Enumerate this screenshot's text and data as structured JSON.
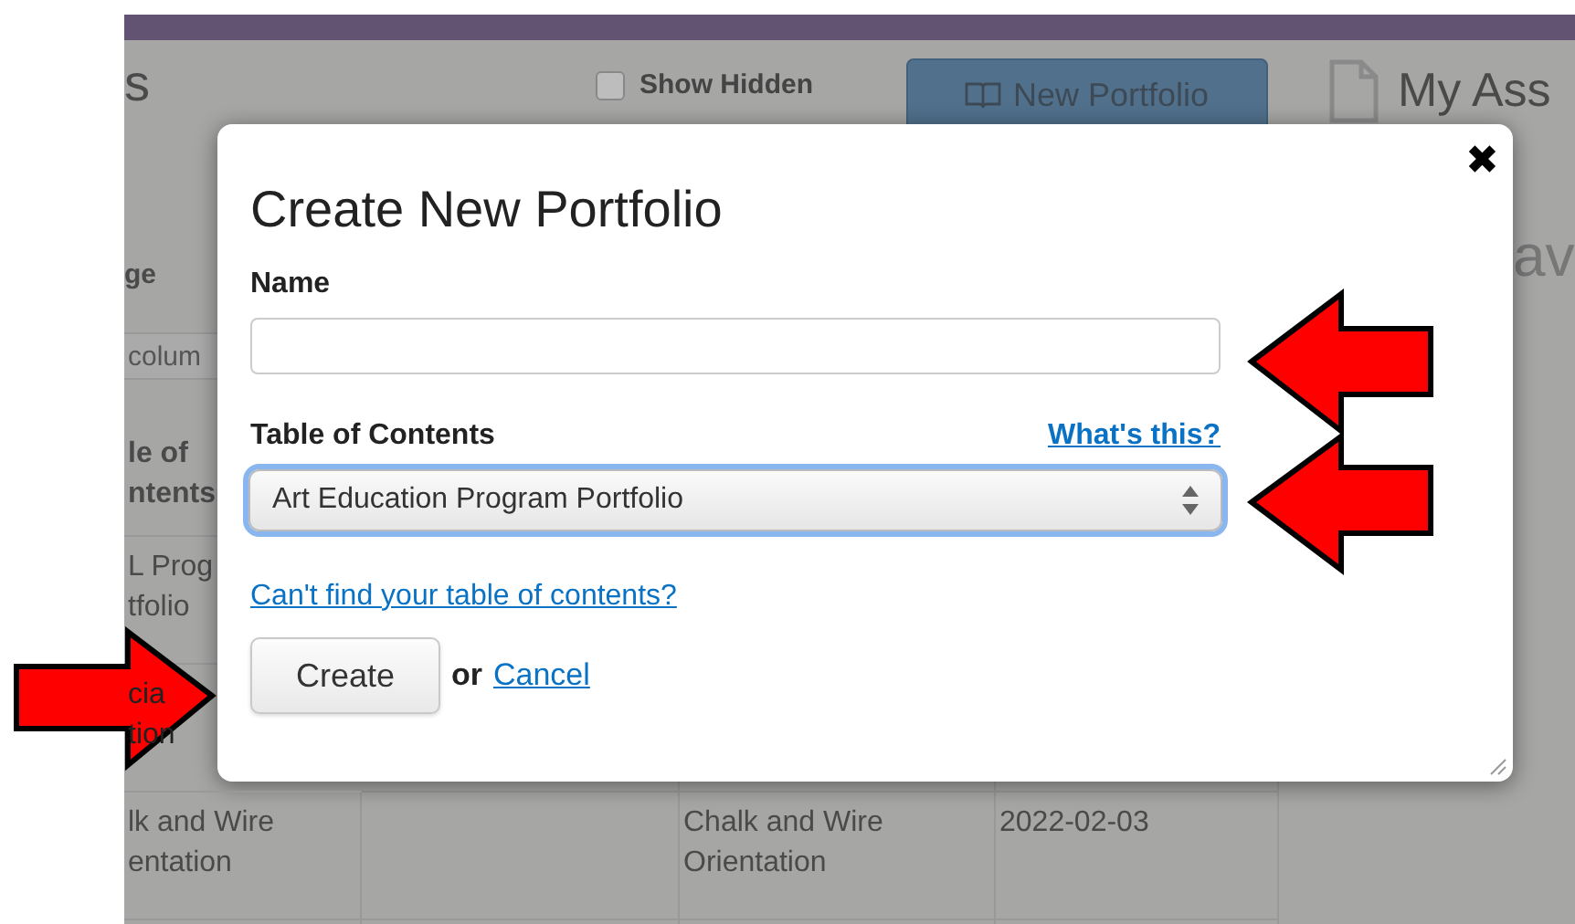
{
  "page": {
    "title_fragment": "s",
    "show_hidden": {
      "label": "Show Hidden",
      "checked": false
    },
    "new_portfolio_button": "New Portfolio",
    "my_assessments": "My Ass",
    "subtitle_fragment": "av",
    "column_label_fragment": "ge",
    "filter_placeholder": "colum"
  },
  "table": {
    "columns": [
      {
        "column_1": [
          "le of",
          "ntents"
        ]
      }
    ],
    "rows": [
      {
        "column_1": [
          "L Prog",
          "tfolio"
        ]
      },
      {
        "column_1": [
          "cia",
          "tion"
        ]
      },
      {
        "column_1": [
          "lk and Wire",
          "entation"
        ],
        "column_3": [
          "Chalk and Wire",
          "Orientation"
        ],
        "column_4": [
          "2022-02-03"
        ]
      }
    ]
  },
  "dialog": {
    "title": "Create New Portfolio",
    "close": "✖",
    "name_label": "Name",
    "toc_label": "Table of Contents",
    "whats_this": "What's this?",
    "toc_value": "Art Education Program Portfolio",
    "toc_focused": true,
    "cant_find": "Can't find your table of contents?",
    "create_button": "Create",
    "or_text": "or",
    "cancel_link": "Cancel"
  }
}
